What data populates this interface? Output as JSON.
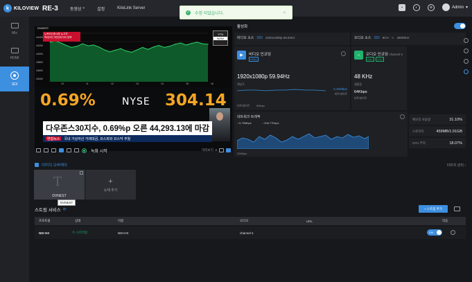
{
  "app": {
    "brand": "KILOVIEW",
    "model": "RE-3"
  },
  "nav": [
    {
      "label": "동영상",
      "caret": "▾"
    },
    {
      "label": "설정",
      "caret": ""
    },
    {
      "label": "KiloLink Server",
      "caret": ""
    }
  ],
  "toast": {
    "message": "수정 되었습니다."
  },
  "user": {
    "name": "Admin"
  },
  "sidebar": [
    {
      "label": "Mix",
      "icon": "mix-icon",
      "active": false
    },
    {
      "label": "HDMI",
      "icon": "hdmi-icon",
      "active": false
    },
    {
      "label": "SDI",
      "icon": "sdi-icon",
      "active": true
    }
  ],
  "preview": {
    "channel": "DVNEST",
    "red_box": [
      "뉴욕3대 증시에 '뉴고자'",
      "빅테크인 3번인버지의 정책"
    ],
    "y_ticks": [
      "44400",
      "44200",
      "44000",
      "43800",
      "43600",
      "43400"
    ],
    "x_ticks": [
      "10",
      "11",
      "12",
      "13",
      "14",
      "15",
      "16"
    ],
    "ytn": "YTN",
    "ytn_sub": "NOW",
    "big_pct": "0.69%",
    "nyse": "NYSE",
    "big_val": "304.14",
    "caption": "다우존스30지수, 0.69%p 오른 44,293.13에 마감",
    "sub_tag": "연합뉴스",
    "sub_text": "국내 가상자산 거래대금, 코스피와 코스닥 추월",
    "record_label": "녹화 시작",
    "mode_label": "미리보기"
  },
  "status": {
    "title": "활성화",
    "video_source": {
      "label": "비디오 소스",
      "badge": "SDI",
      "detail": "1920x1080p 59.94Hz"
    },
    "audio_source": {
      "label": "오디오 소스",
      "badge": "SDI",
      "channels": "8CH",
      "rate": "48000Hz"
    },
    "video_enc": {
      "label": "비디오 인코딩",
      "codec": "H264",
      "resolution": "1920x1080p 59.94Hz",
      "res_label": "해상도",
      "bitrate": "5.46Mbps",
      "bitrate_label": "비트레이트",
      "bitrate_mode_label": "비트레이트",
      "bitrate_mode": "8Mbps"
    },
    "audio_enc": {
      "label": "오디오 인코딩",
      "channel": "channel-1",
      "codec": "AAC",
      "ch": "2CH",
      "samplerate": "48 KHz",
      "sr_label": "샘플링",
      "bitrate": "64Kbps",
      "br_label": "비트레이트"
    },
    "network": {
      "label": "네트워크 트래픽",
      "up": "6.75Mbps",
      "down": "206.77Kbps",
      "scale": "20Mbps"
    },
    "stats": [
      {
        "key": "메모리 사용량",
        "value": "31.10%"
      },
      {
        "key": "스토리지",
        "value": "459MB/1.91GB"
      },
      {
        "key": "CPU 부하",
        "value": "18.07%"
      }
    ]
  },
  "overlay": {
    "title": "이미지 오버레이",
    "manage": "이미지 관리",
    "item_label": "DVNEST",
    "tooltip": "DVNEST",
    "add_label": "소재 추가"
  },
  "stream": {
    "title": "스트림 서비스",
    "add_button": "+ 스트림 추가",
    "columns": [
      "프로토콜",
      "상태",
      "이름",
      "오디오",
      "URL",
      "작동"
    ],
    "rows": [
      {
        "protocol": "NDI HX",
        "status": "스트리밍",
        "name": "NDI-HX",
        "audio": "channel-1",
        "url": "",
        "toggle": "ON"
      }
    ]
  },
  "chart_data": {
    "type": "line",
    "series": [
      {
        "values": [
          44280,
          44310,
          44260,
          44200,
          44150,
          44180,
          44240,
          44190,
          44210,
          44160,
          44090,
          44040,
          44080,
          44120,
          44060,
          44030,
          44090,
          44150,
          44100,
          44160,
          44200,
          44150,
          44180,
          44230,
          44260,
          44210,
          44250,
          44280,
          44240,
          44230
        ]
      }
    ],
    "ylim": [
      43300,
      44500
    ]
  },
  "colors": {
    "accent": "#3d8fe0",
    "green": "#23b26d",
    "orange": "#f6a623"
  }
}
